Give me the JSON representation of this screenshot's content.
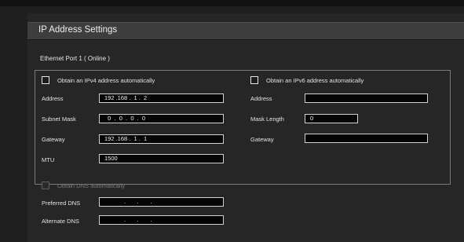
{
  "window": {
    "title": "IP Address Settings"
  },
  "ethernet": {
    "label": "Ethernet Port 1 ( Online )"
  },
  "ipv4": {
    "auto_label": "Obtain an IPv4 address automatically",
    "address_label": "Address",
    "address_value": "192 .168 .  1 .  2",
    "subnet_label": "Subnet Mask",
    "subnet_value": "  0  .  0  .  0  .  0",
    "gateway_label": "Gateway",
    "gateway_value": "192 .168 .  1 .  1",
    "mtu_label": "MTU",
    "mtu_value": "1500"
  },
  "ipv6": {
    "auto_label": "Obtain an IPv6 address automatically",
    "address_label": "Address",
    "address_value": "",
    "mask_label": "Mask Length",
    "mask_value": "0",
    "gateway_label": "Gateway",
    "gateway_value": ""
  },
  "dns": {
    "auto_label": "Obtain DNS automatically",
    "preferred_label": "Preferred DNS",
    "preferred_value": "            .       .       .",
    "alternate_label": "Alternate DNS",
    "alternate_value": "            .       .       ."
  },
  "colors": {
    "background": "#1f1f1f",
    "panel": "#262626",
    "header": "#3e3e3e",
    "field_bg": "#050505",
    "field_border": "#d2d2d2"
  }
}
